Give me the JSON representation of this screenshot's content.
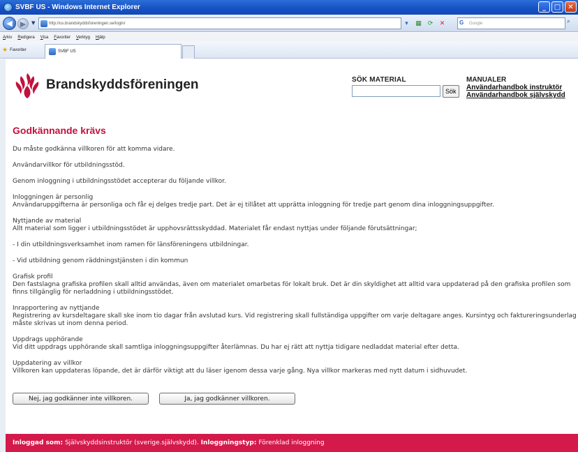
{
  "window": {
    "title": "SVBF US - Windows Internet Explorer"
  },
  "address": {
    "url": "http://us.brandskyddsforeningen.se/login/",
    "search_placeholder": "Google"
  },
  "menu": [
    "Arkiv",
    "Redigera",
    "Visa",
    "Favoriter",
    "Verktyg",
    "Hjälp"
  ],
  "favorites": {
    "label": "Favoriter",
    "tab_title": "SVBF US"
  },
  "header": {
    "brand": "Brandskyddsföreningen",
    "search_title": "SÖK MATERIAL",
    "search_value": "",
    "search_button": "Sök",
    "manuals_title": "MANUALER",
    "manual_links": [
      "Användarhandbok instruktör",
      "Användarhandbok självskydd"
    ]
  },
  "main": {
    "heading": "Godkännande krävs",
    "intro": "Du måste godkänna villkoren för att komma vidare.",
    "terms_title": "Användarvillkor för utbildningsstöd.",
    "terms_lead": "Genom inloggning i utbildningsstödet accepterar du följande villkor.",
    "sections": [
      {
        "title": "Inloggningen är personlig",
        "text": "Användaruppgifterna är personliga och får ej delges tredje part. Det är ej tillåtet att upprätta inloggning för tredje part genom dina inloggningsuppgifter."
      },
      {
        "title": "Nyttjande av material",
        "text": "Allt material som ligger i utbildningsstödet är upphovsrättsskyddad. Materialet får endast nyttjas under följande förutsättningar;"
      }
    ],
    "conditions": [
      "- I din utbildningsverksamhet inom ramen för länsföreningens utbildningar.",
      "- Vid utbildning genom räddningstjänsten i din kommun"
    ],
    "sections2": [
      {
        "title": "Grafisk profil",
        "text": "Den fastslagna grafiska profilen skall alltid användas, även om materialet omarbetas för lokalt bruk. Det är din skyldighet att alltid vara uppdaterad på den grafiska profilen som finns tillgänglig för nerladdning i utbildningsstödet."
      },
      {
        "title": "Inrapportering av nyttjande",
        "text": "Registrering av kursdeltagare skall ske inom tio dagar från avslutad kurs. Vid registrering skall fullständiga uppgifter om varje deltagare anges. Kursintyg och faktureringsunderlag måste skrivas ut inom denna period."
      },
      {
        "title": "Uppdrags upphörande",
        "text": "Vid ditt uppdrags upphörande skall samtliga inloggningsuppgifter återlämnas. Du har ej rätt att nyttja tidigare nedladdat material efter detta."
      },
      {
        "title": "Uppdatering av villkor",
        "text": "Villkoren kan uppdateras löpande, det är därför viktigt att du läser igenom dessa varje gång. Nya villkor markeras med nytt datum i sidhuvudet."
      }
    ],
    "decline_button": "Nej, jag godkänner inte villkoren.",
    "accept_button": "Ja, jag godkänner villkoren."
  },
  "footer": {
    "logged_in_label": "Inloggad som:",
    "logged_in_value": "Självskyddsinstruktör (sverige.självskydd).",
    "login_type_label": "Inloggningstyp:",
    "login_type_value": "Förenklad inloggning"
  },
  "colors": {
    "accent": "#c2113d",
    "footer": "#d31a4b",
    "ie_blue": "#1752c4"
  }
}
